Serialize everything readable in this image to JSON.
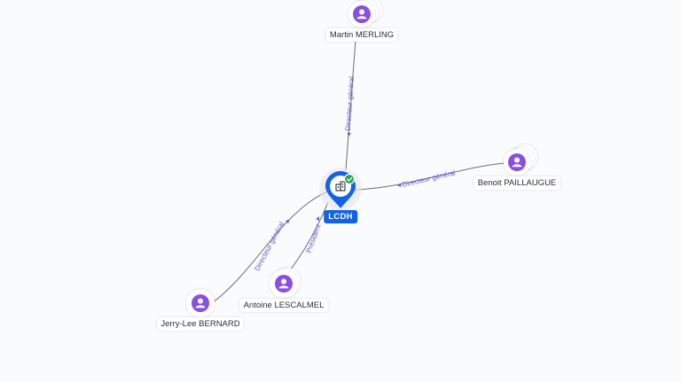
{
  "company": {
    "name": "LCDH",
    "icon": "building-icon",
    "status_icon": "check-circle-icon",
    "color_primary": "#1262e8",
    "color_status": "#2e9e4f"
  },
  "people": [
    {
      "id": "martin",
      "name": "Martin MERLING",
      "icon": "person-icon",
      "stacked": true
    },
    {
      "id": "benoit",
      "name": "Benoit PAILLAUGUE",
      "icon": "person-icon",
      "stacked": true
    },
    {
      "id": "antoine",
      "name": "Antoine LESCALMEL",
      "icon": "person-icon",
      "stacked": true
    },
    {
      "id": "jerry",
      "name": "Jerry-Lee BERNARD",
      "icon": "person-icon",
      "stacked": false
    }
  ],
  "edges": [
    {
      "from": "martin",
      "label": "Directeur général"
    },
    {
      "from": "benoit",
      "label": "Directeur général"
    },
    {
      "from": "antoine",
      "label": "Président"
    },
    {
      "from": "jerry",
      "label": "Directeur général"
    }
  ],
  "colors": {
    "person_icon": "#8a4fe0",
    "edge_label": "#6a56e0",
    "edge_line": "#6b6f7a"
  }
}
